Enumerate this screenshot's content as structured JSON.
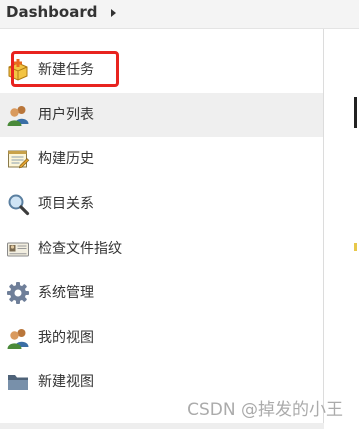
{
  "breadcrumb": {
    "label": "Dashboard"
  },
  "sidebar": {
    "items": [
      {
        "label": "新建任务",
        "icon": "new-item-icon",
        "annotated": true,
        "hovered": false
      },
      {
        "label": "用户列表",
        "icon": "people-icon",
        "annotated": false,
        "hovered": true
      },
      {
        "label": "构建历史",
        "icon": "notepad-icon",
        "annotated": false,
        "hovered": false
      },
      {
        "label": "项目关系",
        "icon": "search-icon",
        "annotated": false,
        "hovered": false
      },
      {
        "label": "检查文件指纹",
        "icon": "fingerprint-icon",
        "annotated": false,
        "hovered": false
      },
      {
        "label": "系统管理",
        "icon": "gear-icon",
        "annotated": false,
        "hovered": false
      },
      {
        "label": "我的视图",
        "icon": "user-icon",
        "annotated": false,
        "hovered": false
      },
      {
        "label": "新建视图",
        "icon": "folder-icon",
        "annotated": false,
        "hovered": false
      }
    ]
  },
  "watermark": {
    "text": "CSDN @掉发的小王"
  },
  "colors": {
    "annotation_border": "#e8231f",
    "hover_background": "#efefef"
  }
}
